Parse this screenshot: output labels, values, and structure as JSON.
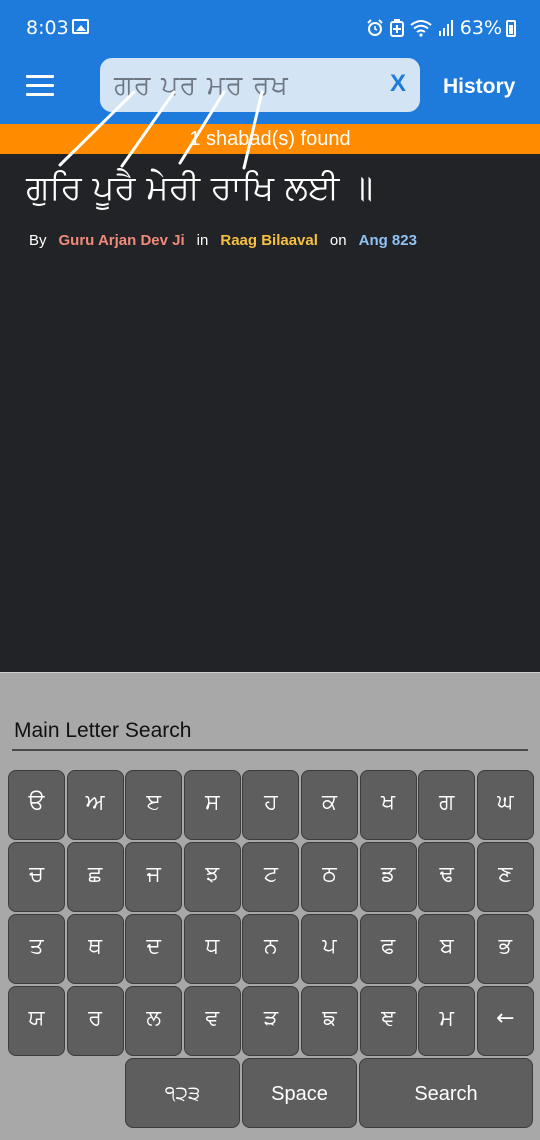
{
  "status_bar": {
    "time": "8:03",
    "battery": "63%",
    "icons": [
      "gallery-icon",
      "alarm-icon",
      "battery-saver-icon",
      "wifi-icon",
      "signal-icon",
      "battery-icon"
    ]
  },
  "app_bar": {
    "menu_icon": "hamburger-menu-icon",
    "search_value": "ਗਰ ਪਰ ਮਰ ਰਖ",
    "clear_label": "X",
    "history_label": "History"
  },
  "results": {
    "banner": "1 shabad(s) found",
    "line": "ਗੁਰਿ ਪੂਰੈ ਮੇਰੀ ਰਾਖਿ ਲਈ ॥",
    "by_label": "By",
    "author": "Guru Arjan Dev Ji",
    "in_label": "in",
    "raag": "Raag Bilaaval",
    "on_label": "on",
    "ang": "Ang 823"
  },
  "colors": {
    "primary": "#1e7bdc",
    "banner": "#ff8c00",
    "background": "#222326",
    "author": "#f08a7a",
    "raag": "#f5c044",
    "ang": "#8fc3f5"
  },
  "keyboard": {
    "title": "Main Letter Search",
    "rows": [
      [
        "ੳ",
        "ਅ",
        "ੲ",
        "ਸ",
        "ਹ",
        "ਕ",
        "ਖ",
        "ਗ",
        "ਘ"
      ],
      [
        "ਚ",
        "ਛ",
        "ਜ",
        "ਝ",
        "ਟ",
        "ਠ",
        "ਡ",
        "ਢ",
        "ਣ"
      ],
      [
        "ਤ",
        "ਥ",
        "ਦ",
        "ਧ",
        "ਨ",
        "ਪ",
        "ਫ",
        "ਬ",
        "ਭ"
      ],
      [
        "ਯ",
        "ਰ",
        "ਲ",
        "ਵ",
        "ੜ",
        "ਙ",
        "ਞ",
        "ਮ",
        "←"
      ]
    ],
    "numbers_label": "੧੨੩",
    "space_label": "Space",
    "search_label": "Search"
  }
}
